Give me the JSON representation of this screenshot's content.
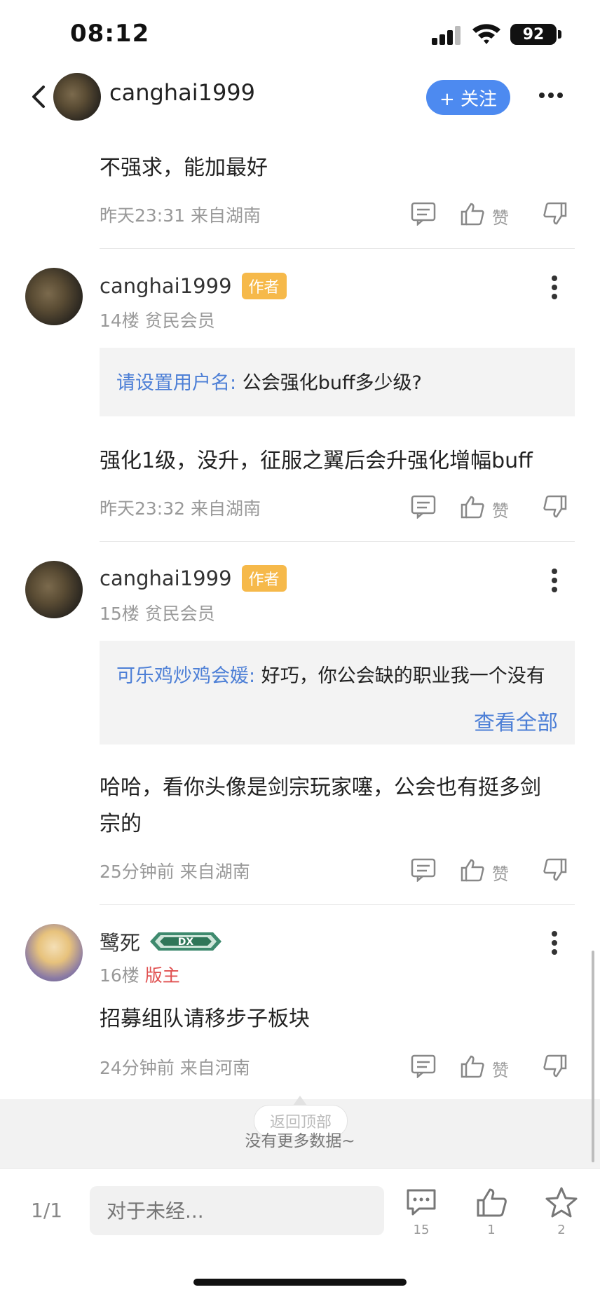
{
  "status_bar": {
    "time": "08:12",
    "battery": "92"
  },
  "header": {
    "username": "canghai1999",
    "follow_label": "+ 关注"
  },
  "posts": [
    {
      "content": "不强求，能加最好",
      "time": "昨天23:31",
      "location": "来自湖南",
      "like_label": "赞"
    },
    {
      "username": "canghai1999",
      "author_badge": "作者",
      "floor": "14楼",
      "rank": "贫民会员",
      "quote_name": "请设置用户名:",
      "quote_text": "公会强化buff多少级?",
      "content": "强化1级，没升，征服之翼后会升强化增幅buff",
      "time": "昨天23:32",
      "location": "来自湖南",
      "like_label": "赞"
    },
    {
      "username": "canghai1999",
      "author_badge": "作者",
      "floor": "15楼",
      "rank": "贫民会员",
      "quote_name": "可乐鸡炒鸡会媛:",
      "quote_text": "好巧，你公会缺的职业我一个没有",
      "view_all": "查看全部",
      "content_line1": "哈哈，看你头像是剑宗玩家噻，公会也有挺多剑",
      "content_line2": "宗的",
      "time": "25分钟前",
      "location": "来自湖南",
      "like_label": "赞"
    },
    {
      "username": "鹭死",
      "level_badge": "DX",
      "floor": "16楼",
      "role": "版主",
      "content": "招募组队请移步子板块",
      "time": "24分钟前",
      "location": "来自河南",
      "like_label": "赞"
    }
  ],
  "footer": {
    "no_more": "没有更多数据~",
    "back_to_top": "返回顶部"
  },
  "bottom_bar": {
    "page": "1/1",
    "reply_placeholder": "对于未经...",
    "comment_count": "15",
    "like_count": "1",
    "star_count": "2"
  }
}
